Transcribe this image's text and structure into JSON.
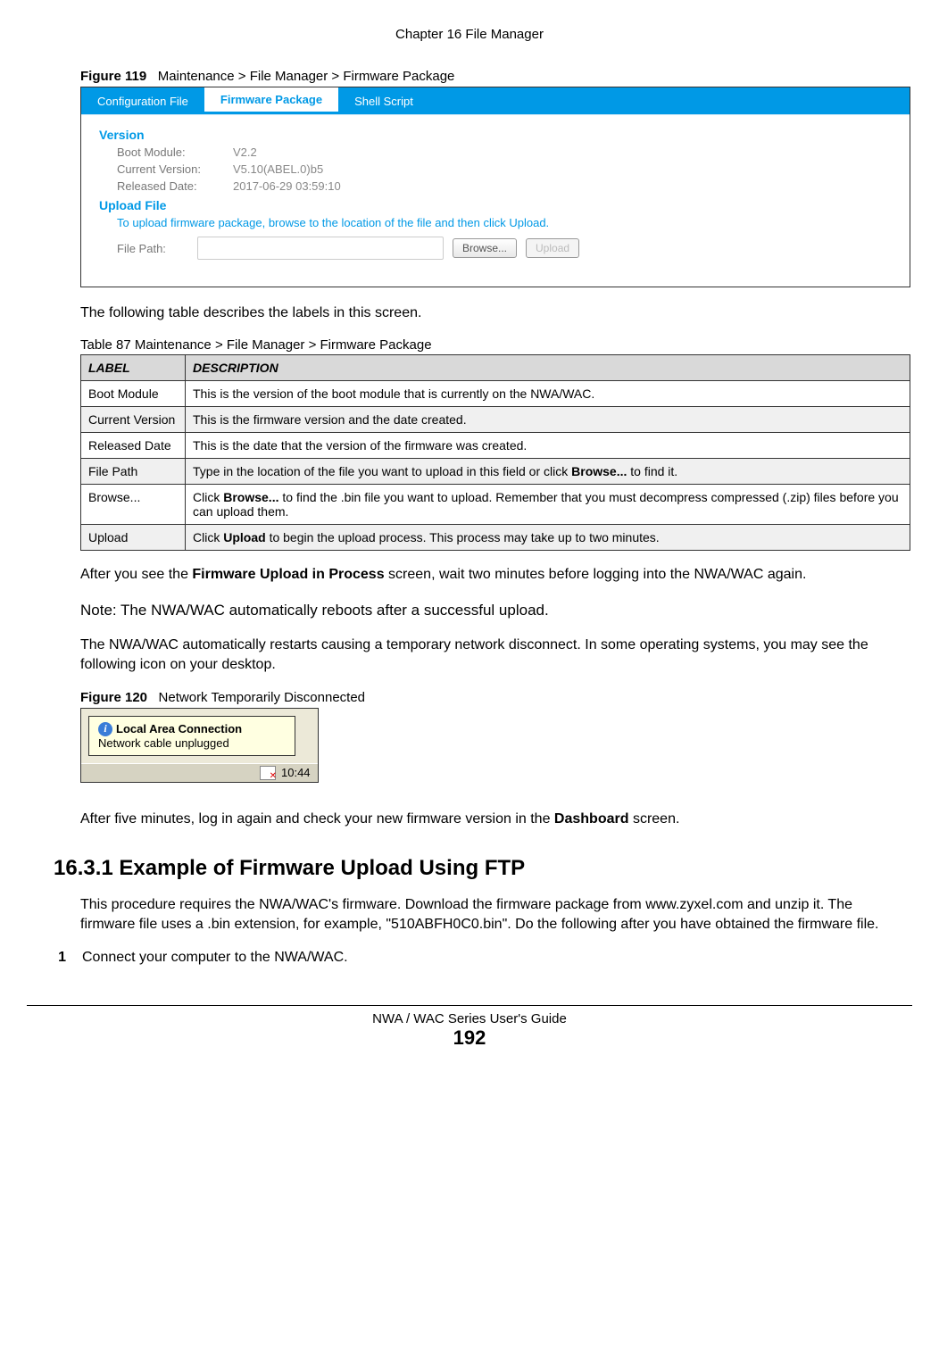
{
  "header": "Chapter 16 File Manager",
  "fig119": {
    "num": "Figure 119",
    "title": "Maintenance > File Manager > Firmware Package"
  },
  "screenshot1": {
    "tabs": {
      "conf": "Configuration File",
      "fw": "Firmware Package",
      "shell": "Shell Script"
    },
    "version_section": "Version",
    "boot_label": "Boot Module:",
    "boot_val": "V2.2",
    "curver_label": "Current Version:",
    "curver_val": "V5.10(ABEL.0)b5",
    "reldate_label": "Released Date:",
    "reldate_val": "2017-06-29 03:59:10",
    "upload_section": "Upload File",
    "help_text": "To upload firmware package, browse to the location of the file and then click Upload.",
    "filepath_label": "File Path:",
    "browse_btn": "Browse...",
    "upload_btn": "Upload"
  },
  "para1": "The following table describes the labels in this screen.",
  "table87": {
    "caption": "Table 87   Maintenance > File Manager > Firmware Package",
    "head_label": "LABEL",
    "head_desc": "DESCRIPTION",
    "rows": [
      {
        "label": "Boot Module",
        "desc": "This is the version of the boot module that is currently on the NWA/WAC."
      },
      {
        "label": "Current Version",
        "desc": "This is the firmware version and the date created."
      },
      {
        "label": "Released Date",
        "desc": "This is the date that the version of the firmware was created."
      },
      {
        "label": "File Path",
        "desc_prefix": "Type in the location of the file you want to upload in this field or click ",
        "bold1": "Browse...",
        "desc_suffix": " to find it."
      },
      {
        "label": "Browse...",
        "desc_prefix": "Click ",
        "bold1": "Browse...",
        "desc_suffix": " to find the .bin file you want to upload. Remember that you must decompress compressed (.zip) files before you can upload them."
      },
      {
        "label": "Upload",
        "desc_prefix": "Click ",
        "bold1": "Upload",
        "desc_suffix": " to begin the upload process. This process may take up to two minutes."
      }
    ]
  },
  "para2_pre": "After you see the ",
  "para2_bold": "Firmware Upload in Process",
  "para2_post": " screen, wait two minutes before logging into the NWA/WAC again.",
  "note": "Note: The NWA/WAC automatically reboots after a successful upload.",
  "para3": "The NWA/WAC automatically restarts causing a temporary network disconnect. In some operating systems, you may see the following icon on your desktop.",
  "fig120": {
    "num": "Figure 120",
    "title": "Network Temporarily Disconnected"
  },
  "screenshot2": {
    "balloon_title": "Local Area Connection",
    "balloon_text": "Network cable unplugged",
    "time": "10:44"
  },
  "para4_pre": "After five minutes, log in again and check your new firmware version in the ",
  "para4_bold": "Dashboard",
  "para4_post": " screen.",
  "h2": "16.3.1  Example of Firmware Upload Using FTP",
  "para5": "This procedure requires the NWA/WAC's firmware. Download the firmware package from www.zyxel.com and unzip it. The firmware file uses a .bin extension, for example, \"510ABFH0C0.bin\". Do the following after you have obtained the firmware file.",
  "step1_num": "1",
  "step1_text": "Connect your computer to the NWA/WAC.",
  "footer": {
    "text": "NWA / WAC Series User's Guide",
    "page": "192"
  }
}
